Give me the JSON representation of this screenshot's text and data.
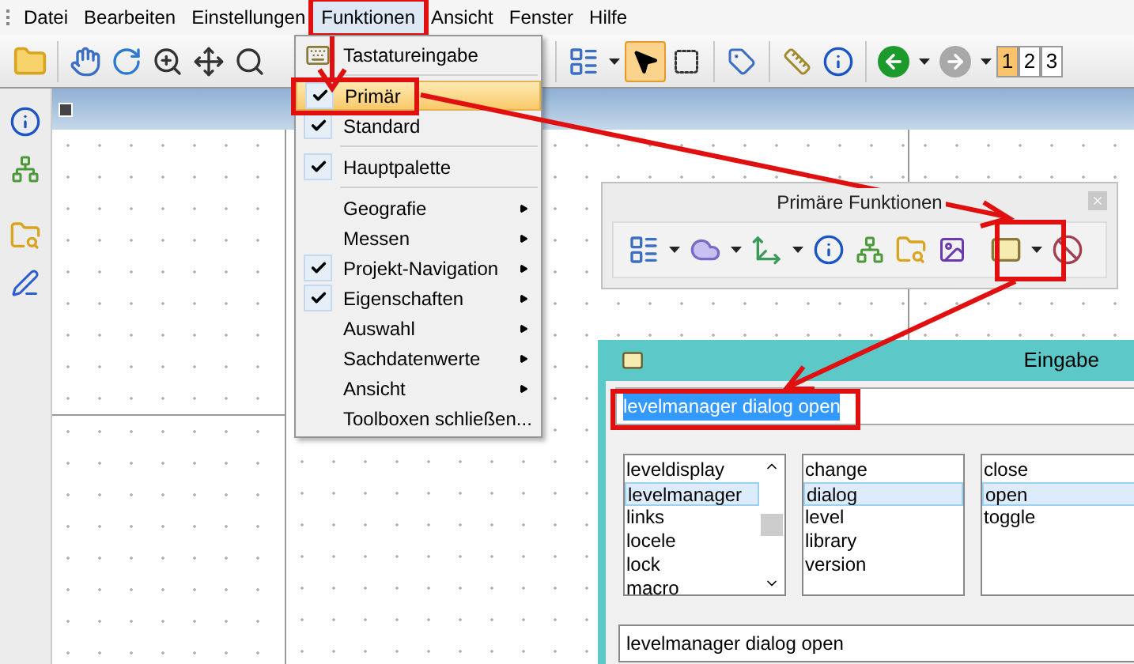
{
  "menubar": [
    {
      "label": "Datei",
      "selected": false
    },
    {
      "label": "Bearbeiten",
      "selected": false
    },
    {
      "label": "Einstellungen",
      "selected": false
    },
    {
      "label": "Funktionen",
      "selected": true
    },
    {
      "label": "Ansicht",
      "selected": false
    },
    {
      "label": "Fenster",
      "selected": false
    },
    {
      "label": "Hilfe",
      "selected": false
    }
  ],
  "toolbar": {
    "pointer_tool": {
      "selected": true
    },
    "pages": [
      {
        "label": "1",
        "selected": true
      },
      {
        "label": "2",
        "selected": false
      },
      {
        "label": "3",
        "selected": false
      }
    ]
  },
  "menu": {
    "items": [
      {
        "kind": "icon_item",
        "label": "Tastatureingabe",
        "checked": false,
        "submenu": false,
        "selected": false
      },
      {
        "kind": "separator"
      },
      {
        "kind": "item",
        "label": "Primär",
        "checked": true,
        "submenu": false,
        "selected": true
      },
      {
        "kind": "item",
        "label": "Standard",
        "checked": true,
        "submenu": false,
        "selected": false
      },
      {
        "kind": "separator"
      },
      {
        "kind": "item",
        "label": "Hauptpalette",
        "checked": true,
        "submenu": false,
        "selected": false
      },
      {
        "kind": "separator"
      },
      {
        "kind": "item",
        "label": "Geografie",
        "checked": false,
        "submenu": true,
        "selected": false
      },
      {
        "kind": "item",
        "label": "Messen",
        "checked": false,
        "submenu": true,
        "selected": false
      },
      {
        "kind": "item",
        "label": "Projekt-Navigation",
        "checked": true,
        "submenu": true,
        "selected": false
      },
      {
        "kind": "item",
        "label": "Eigenschaften",
        "checked": true,
        "submenu": true,
        "selected": false
      },
      {
        "kind": "item",
        "label": "Auswahl",
        "checked": false,
        "submenu": true,
        "selected": false
      },
      {
        "kind": "item",
        "label": "Sachdatenwerte",
        "checked": false,
        "submenu": true,
        "selected": false
      },
      {
        "kind": "item",
        "label": "Ansicht",
        "checked": false,
        "submenu": true,
        "selected": false
      },
      {
        "kind": "item",
        "label": "Toolboxen schließen...",
        "checked": false,
        "submenu": false,
        "selected": false
      }
    ]
  },
  "toolbox": {
    "title": "Primäre Funktionen"
  },
  "key_in": {
    "title": "Eingabe",
    "command": {
      "value": "levelmanager dialog open",
      "text_selected": true
    },
    "lists": [
      {
        "items": [
          {
            "label": "leveldisplay",
            "selected": false
          },
          {
            "label": "levelmanager",
            "selected": true
          },
          {
            "label": "links",
            "selected": false
          },
          {
            "label": "locele",
            "selected": false
          },
          {
            "label": "lock",
            "selected": false
          },
          {
            "label": "macro",
            "selected": false
          }
        ]
      },
      {
        "items": [
          {
            "label": "change",
            "selected": false
          },
          {
            "label": "dialog",
            "selected": true
          },
          {
            "label": "level",
            "selected": false
          },
          {
            "label": "library",
            "selected": false
          },
          {
            "label": "version",
            "selected": false
          }
        ]
      },
      {
        "items": [
          {
            "label": "close",
            "selected": false
          },
          {
            "label": "open",
            "selected": true
          },
          {
            "label": "toggle",
            "selected": false
          }
        ]
      }
    ],
    "history": {
      "value": "levelmanager dialog open"
    }
  }
}
